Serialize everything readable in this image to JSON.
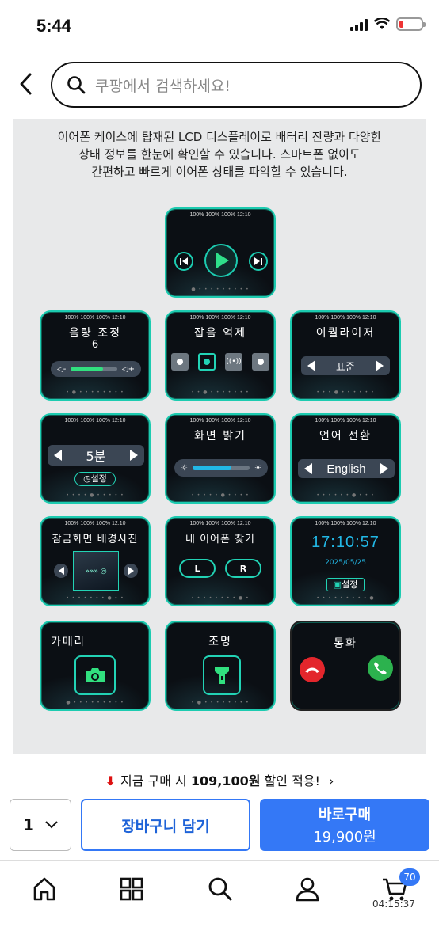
{
  "status": {
    "time": "5:44"
  },
  "search": {
    "placeholder": "쿠팡에서 검색하세요!"
  },
  "description": [
    "이어폰 케이스에 탑재된 LCD 디스플레이로 배터리 잔량과 다양한",
    "상태 정보를 한눈에 확인할 수 있습니다. 스마트폰 없이도",
    "간편하고 빠르게 이어폰 상태를 파악할 수 있습니다."
  ],
  "device_status": "100% 100% 100% 12:10",
  "screens": {
    "volume": {
      "title": "음량 조정",
      "value": "6"
    },
    "noise": {
      "title": "잡음 억제"
    },
    "eq": {
      "title": "이퀄라이저",
      "value": "표준"
    },
    "timer": {
      "value": "5분",
      "button": "설정"
    },
    "brightness": {
      "title": "화면 밝기"
    },
    "language": {
      "title": "언어 전환",
      "value": "English"
    },
    "wallpaper": {
      "title": "잠금화면 배경사진"
    },
    "find": {
      "title": "내 이어폰 찾기",
      "left": "L",
      "right": "R"
    },
    "clock": {
      "time": "17:10:57",
      "date": "2025/05/25",
      "button": "설정"
    },
    "camera": {
      "title": "카메라"
    },
    "light": {
      "title": "조명"
    },
    "call": {
      "title": "통화"
    }
  },
  "promo": {
    "prefix": "지금 구매 시 ",
    "amount": "109,100원",
    "suffix": " 할인 적용!"
  },
  "purchase": {
    "quantity": "1",
    "cart_label": "장바구니 담기",
    "buy_label": "바로구매",
    "price": "19,900원"
  },
  "tabbar": {
    "cart_badge": "70",
    "timer": "04:15:37"
  },
  "colors": {
    "accent": "#3478f6",
    "teal": "#1ccbb0",
    "promo_red": "#d11111"
  }
}
